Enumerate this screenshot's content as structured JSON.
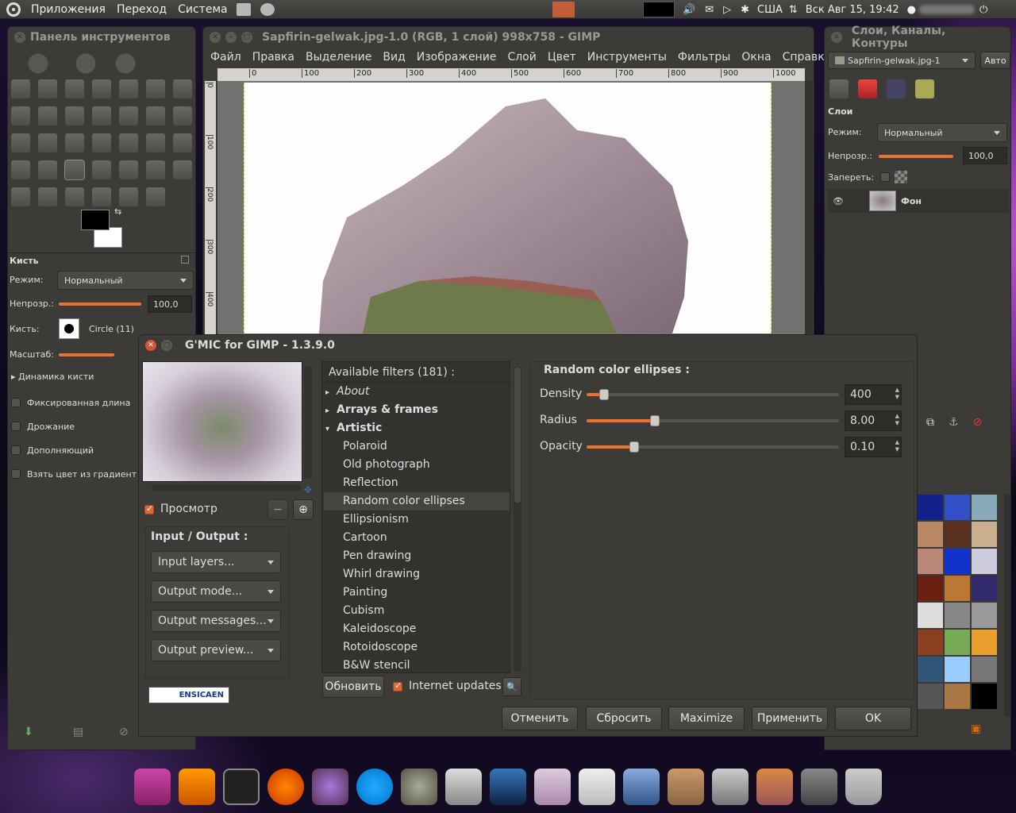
{
  "topbar": {
    "menus": [
      "Приложения",
      "Переход",
      "Система"
    ],
    "keyboard": "США",
    "datetime": "Вск Авг 15, 19:42"
  },
  "toolbox": {
    "title": "Панель инструментов",
    "section": "Кисть",
    "mode_label": "Режим:",
    "mode_value": "Нормальный",
    "opacity_label": "Непрозр.:",
    "opacity_value": "100,0",
    "opacity_fraction": 1.0,
    "brush_label": "Кисть:",
    "brush_value": "Circle (11)",
    "scale_label": "Масштаб:",
    "dynamics": "Динамика кисти",
    "options": [
      "Фиксированная длина",
      "Дрожание",
      "Дополняющий",
      "Взять цвет из градиент"
    ]
  },
  "image_window": {
    "title": "Sapfirin-gelwak.jpg-1.0 (RGB, 1 слой) 998x758 - GIMP",
    "menu": [
      "Файл",
      "Правка",
      "Выделение",
      "Вид",
      "Изображение",
      "Слой",
      "Цвет",
      "Инструменты",
      "Фильтры",
      "Окна",
      "Справка"
    ],
    "ruler_ticks": [
      "0",
      "100",
      "200",
      "300",
      "400",
      "500",
      "600",
      "700",
      "800",
      "900",
      "1000"
    ],
    "vruler_ticks": [
      "0",
      "100",
      "200",
      "300",
      "400"
    ]
  },
  "layers": {
    "title": "Слои, Каналы, Контуры",
    "image_select": "Sapfirin-gelwak.jpg-1",
    "auto": "Авто",
    "section": "Слои",
    "mode_label": "Режим:",
    "mode_value": "Нормальный",
    "opacity_label": "Непрозр.:",
    "opacity_value": "100,0",
    "opacity_fraction": 1.0,
    "lock_label": "Запереть:",
    "layer_name": "Фон"
  },
  "gmic": {
    "title": "G'MIC for GIMP - 1.3.9.0",
    "preview_label": "Просмотр",
    "io_title": "Input / Output :",
    "io_combos": [
      "Input layers...",
      "Output mode...",
      "Output messages...",
      "Output preview..."
    ],
    "logo_text": "ENSICAEN",
    "filters_header": "Available filters (181) :",
    "categories": [
      {
        "label": "About",
        "expanded": false,
        "italic": true
      },
      {
        "label": "Arrays & frames",
        "expanded": false,
        "bold": true
      },
      {
        "label": "Artistic",
        "expanded": true,
        "bold": true
      }
    ],
    "artistic_items": [
      "Polaroid",
      "Old photograph",
      "Reflection",
      "Random color ellipses",
      "Ellipsionism",
      "Cartoon",
      "Pen drawing",
      "Whirl drawing",
      "Painting",
      "Cubism",
      "Kaleidoscope",
      "Rotoidoscope",
      "B&W stencil"
    ],
    "selected_item": "Random color ellipses",
    "refresh_button": "Обновить",
    "internet_updates": "Internet updates",
    "filter_title": "Random color ellipses :",
    "params": [
      {
        "name": "Density",
        "value": "400",
        "fraction": 0.07
      },
      {
        "name": "Radius",
        "value": "8.00",
        "fraction": 0.27
      },
      {
        "name": "Opacity",
        "value": "0.10",
        "fraction": 0.19
      }
    ],
    "buttons": [
      "Отменить",
      "Сбросить",
      "Maximize",
      "Применить",
      "OK"
    ]
  },
  "colors": {
    "accent": "#e9732e",
    "panel": "#3c3b38"
  }
}
